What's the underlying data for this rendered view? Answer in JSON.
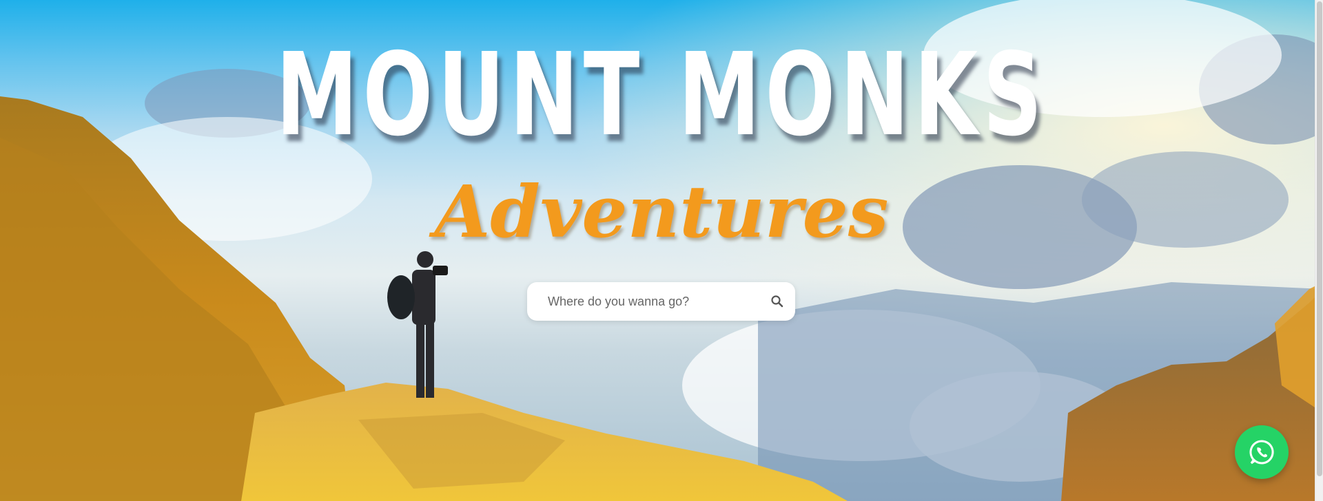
{
  "hero": {
    "title": "MOUNT MONKS",
    "subtitle": "Adventures"
  },
  "search": {
    "placeholder": "Where do you wanna go?",
    "icon": "search-icon"
  },
  "floating": {
    "icon": "whatsapp-icon",
    "color": "#25d366"
  },
  "colors": {
    "title": "#ffffff",
    "subtitle": "#f39a1d",
    "sky": "#1fb0ea"
  }
}
